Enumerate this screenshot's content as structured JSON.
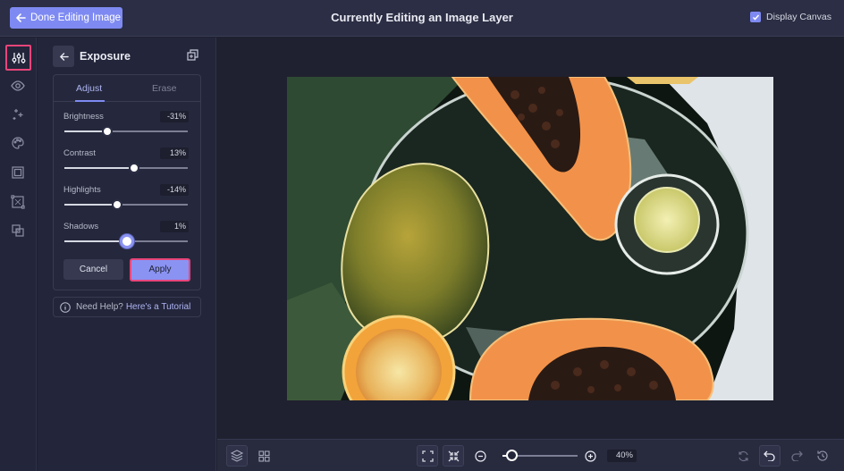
{
  "header": {
    "done_label": "Done Editing Image",
    "title": "Currently Editing an Image Layer",
    "display_canvas_label": "Display Canvas",
    "display_canvas_checked": true
  },
  "sidebar": {
    "icons": [
      "adjust-sliders-icon",
      "eye-icon",
      "sparkles-icon",
      "palette-icon",
      "frame-icon",
      "transform-icon",
      "layers-overlap-icon"
    ],
    "active_index": 0
  },
  "panel": {
    "title": "Exposure",
    "tabs": [
      "Adjust",
      "Erase"
    ],
    "active_tab": "Adjust",
    "sliders": [
      {
        "label": "Brightness",
        "value_text": "-31%",
        "value": -31,
        "min": -100,
        "max": 100
      },
      {
        "label": "Contrast",
        "value_text": "13%",
        "value": 13,
        "min": -100,
        "max": 100
      },
      {
        "label": "Highlights",
        "value_text": "-14%",
        "value": -14,
        "min": -100,
        "max": 100
      },
      {
        "label": "Shadows",
        "value_text": "1%",
        "value": 1,
        "min": -100,
        "max": 100
      }
    ],
    "cancel_label": "Cancel",
    "apply_label": "Apply",
    "help_question": "Need Help?",
    "help_link": "Here's a Tutorial"
  },
  "bottombar": {
    "zoom_text": "40%",
    "zoom_fraction": 0.12
  },
  "colors": {
    "accent": "#7e8af2",
    "highlight_border": "#e8457a",
    "papaya_flesh": "#f2924a",
    "seed": "#2a1a14"
  }
}
